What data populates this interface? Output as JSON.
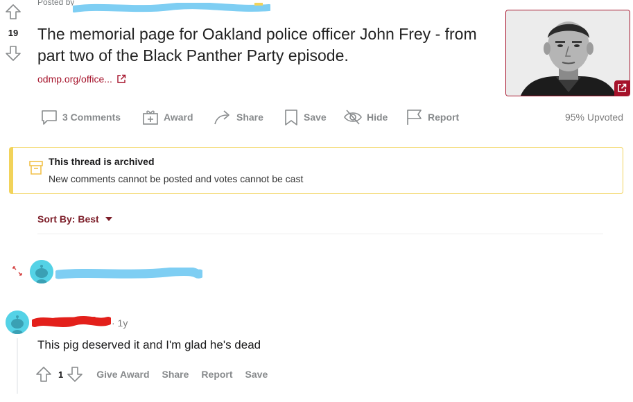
{
  "post": {
    "vote_count": "19",
    "posted_by_prefix": "Posted by",
    "title": "The memorial page for Oakland police officer John Frey - from part two of the Black Panther Party episode.",
    "link_text": "odmp.org/office...",
    "actions": {
      "comments": "3 Comments",
      "award": "Award",
      "share": "Share",
      "save": "Save",
      "hide": "Hide",
      "report": "Report"
    },
    "upvoted": "95% Upvoted"
  },
  "archived": {
    "title": "This thread is archived",
    "subtitle": "New comments cannot be posted and votes cannot be cast"
  },
  "sort": {
    "label": "Sort By: Best"
  },
  "comment": {
    "time": "· 1y",
    "body": "This pig deserved it and I'm glad he's dead",
    "score": "1",
    "actions": {
      "give_award": "Give Award",
      "share": "Share",
      "report": "Report",
      "save": "Save"
    }
  },
  "colors": {
    "accent_link": "#a5122a",
    "archived_border": "#f2d35a",
    "avatar_bg": "#54d2e6",
    "redaction_blue": "#7ecef3",
    "redaction_red": "#e3201b"
  }
}
